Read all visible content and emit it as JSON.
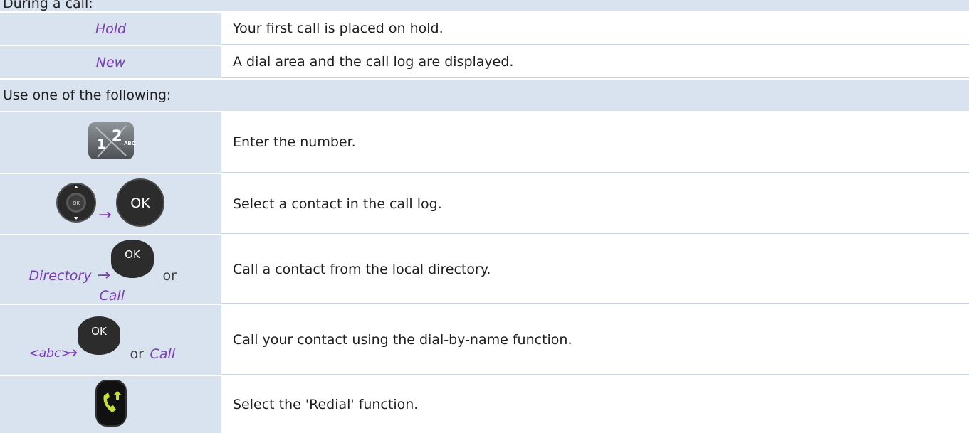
{
  "top_row_text": "During a call:",
  "rows": [
    {
      "key": "Hold",
      "desc": "Your first call is placed on hold."
    },
    {
      "key": "New",
      "desc": "A dial area and the call log are displayed."
    }
  ],
  "section_header": "Use one of the following:",
  "options": [
    {
      "desc": "Enter the number.",
      "icon": "keypad-icon",
      "digits": [
        "1",
        "2"
      ],
      "letters": "ABC"
    },
    {
      "desc": "Select a contact in the call log.",
      "icons": [
        "navigator-ok-icon",
        "ok-button-icon"
      ],
      "arrow": "→",
      "ok": "OK"
    },
    {
      "key": "Directory",
      "arrow": "→",
      "ok": "OK",
      "or": "or",
      "alt": "Call",
      "desc": "Call a contact from the local directory."
    },
    {
      "key": "<abc>",
      "arrow": "→",
      "ok": "OK",
      "or": "or",
      "alt": "Call",
      "desc": "Call your contact using the dial-by-name function."
    },
    {
      "icon": "redial-icon",
      "desc": "Select the 'Redial' function."
    }
  ],
  "colors": {
    "header_bg": "#d9e2ef",
    "accent": "#7a3bb5",
    "redial_green": "#c6e03a"
  }
}
